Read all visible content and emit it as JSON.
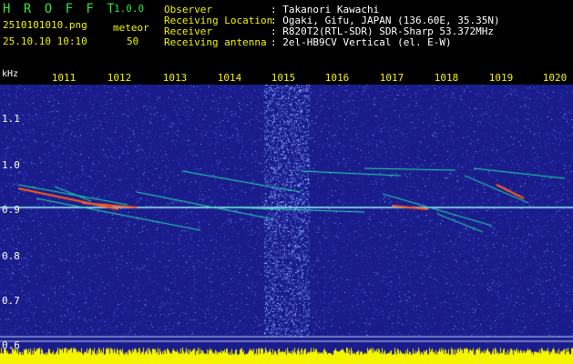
{
  "app": {
    "name": "H R O F F T",
    "version": "1.0.0"
  },
  "file": {
    "name": "2510101010.png",
    "datetime": "25.10.10 10:10"
  },
  "meteor": {
    "label": "meteor",
    "count": "50"
  },
  "info": [
    {
      "label": "Observer",
      "value": ": Takanori Kawachi"
    },
    {
      "label": "Receiving Location",
      "value": ": Ogaki, Gifu, JAPAN (136.60E, 35.35N)"
    },
    {
      "label": "Receiver",
      "value": ": R820T2(RTL-SDR) SDR-Sharp 53.372MHz"
    },
    {
      "label": "Receiving antenna",
      "value": ": 2el-HB9CV Vertical (el. E-W)"
    }
  ],
  "spectrogram": {
    "y_unit": "kHz",
    "x_ticks": [
      "1011",
      "1012",
      "1013",
      "1014",
      "1015",
      "1016",
      "1017",
      "1018",
      "1019",
      "1020"
    ],
    "y_ticks": [
      "1.1",
      "1.0",
      "0.9",
      "0.8",
      "0.7",
      "0.6"
    ],
    "colors": {
      "background": "#1a1c8c",
      "noise": "#3a5cd8",
      "beacon": "#9ef5ff",
      "trail_hot": "#ff5a1e",
      "trail": "#22e0a8",
      "power": "#f5f500"
    }
  }
}
